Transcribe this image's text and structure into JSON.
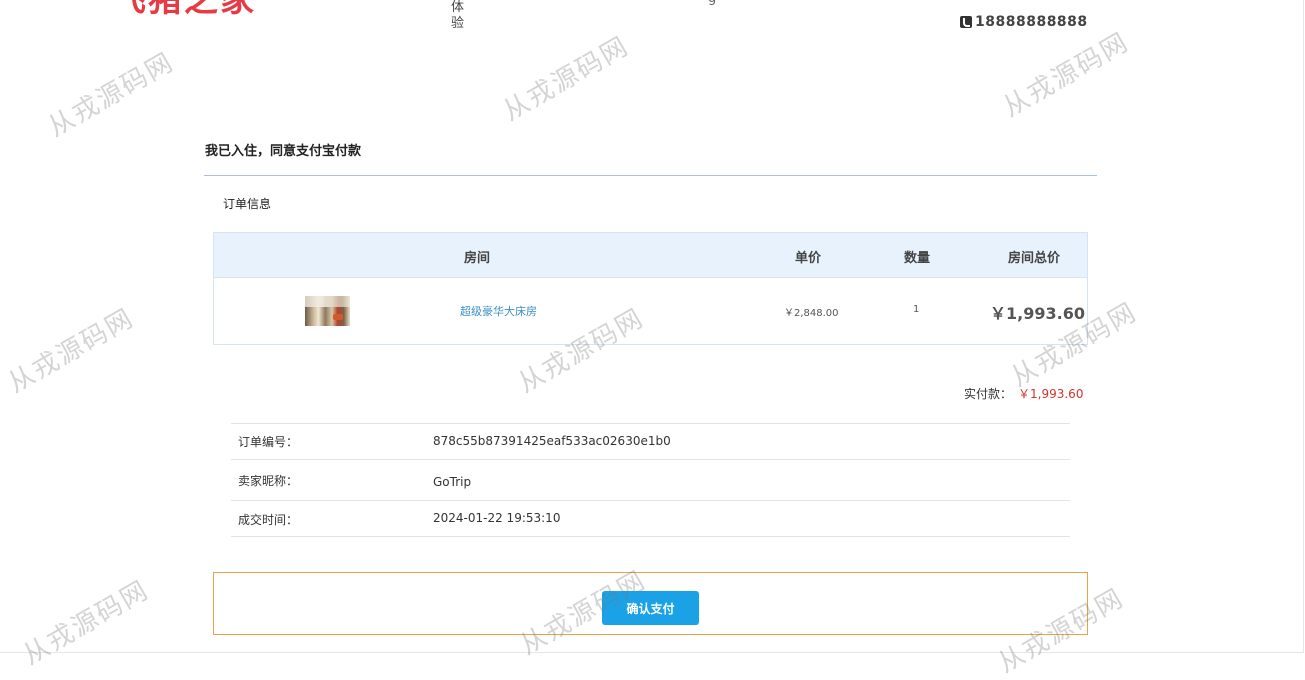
{
  "header": {
    "logo_text": "飞猪之家",
    "nav_fragment": "体验",
    "nav_fragment2": "g",
    "phone": "18888888888"
  },
  "page": {
    "title": "我已入住，同意支付宝付款",
    "section_title": "订单信息"
  },
  "table": {
    "headers": {
      "room": "房间",
      "price": "单价",
      "qty": "数量",
      "total": "房间总价"
    },
    "row": {
      "room_name": "超级豪华大床房",
      "unit_price": "￥2,848.00",
      "qty": "1",
      "total": "￥1,993.60"
    }
  },
  "paid": {
    "label": "实付款：",
    "value": "￥1,993.60"
  },
  "info": [
    {
      "label": "订单编号：",
      "value": "878c55b87391425eaf533ac02630e1b0"
    },
    {
      "label": "卖家昵称：",
      "value": "GoTrip"
    },
    {
      "label": "成交时间：",
      "value": "2024-01-22 19:53:10"
    }
  ],
  "confirm": {
    "label": "确认支付"
  },
  "watermark": "从戎源码网",
  "colors": {
    "accent": "#1aa1e6",
    "price_red": "#d0342c",
    "link_blue": "#3b8fc7",
    "header_bg": "#e8f2fc",
    "confirm_border": "#e8a24a",
    "logo_red": "#e83a45"
  }
}
